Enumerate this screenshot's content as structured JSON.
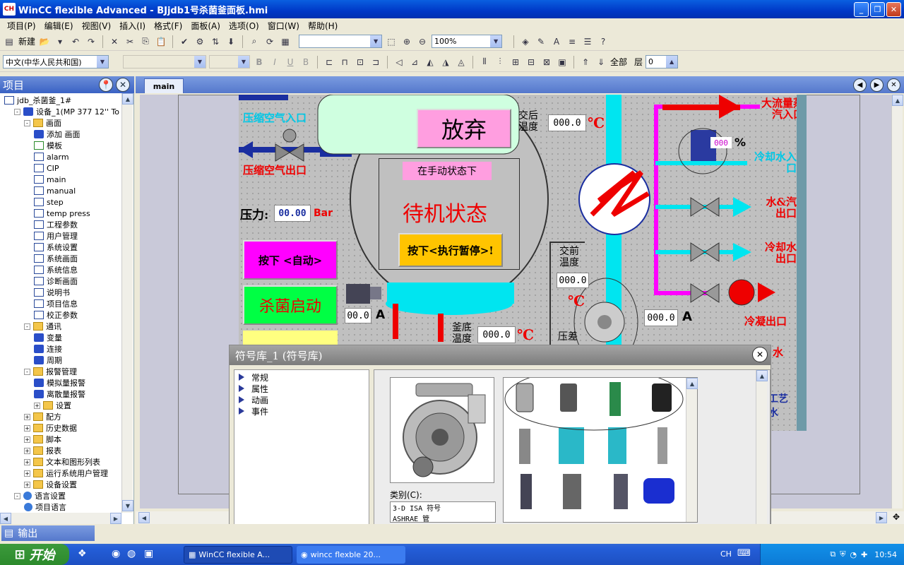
{
  "window": {
    "title": "WinCC flexible Advanced - BJjdb1号杀菌釜面板.hmi",
    "app_icon": "CH"
  },
  "menu": [
    "项目(P)",
    "编辑(E)",
    "视图(V)",
    "插入(I)",
    "格式(F)",
    "面板(A)",
    "选项(O)",
    "窗口(W)",
    "帮助(H)"
  ],
  "toolbar": {
    "new_label": "新建",
    "zoom_value": "100%",
    "language_value": "中文(中华人民共和国)",
    "all_label": "全部",
    "layer_label": "层",
    "layer_value": "0"
  },
  "project": {
    "header": "项目",
    "tree": [
      {
        "label": "jdb_杀菌釜_1#",
        "indent": 0,
        "icon": "project-icon"
      },
      {
        "label": "设备_1(MP 377 12'' To",
        "indent": 1,
        "icon": "device-icon",
        "exp": "-"
      },
      {
        "label": "画面",
        "indent": 2,
        "icon": "folder-icon",
        "exp": "-"
      },
      {
        "label": "添加 画面",
        "indent": 3,
        "icon": "add-screen-icon"
      },
      {
        "label": "模板",
        "indent": 3,
        "icon": "template-icon"
      },
      {
        "label": "alarm",
        "indent": 3,
        "icon": "screen-icon"
      },
      {
        "label": "CIP",
        "indent": 3,
        "icon": "screen-icon"
      },
      {
        "label": "main",
        "indent": 3,
        "icon": "screen-icon"
      },
      {
        "label": "manual",
        "indent": 3,
        "icon": "screen-icon"
      },
      {
        "label": "step",
        "indent": 3,
        "icon": "screen-icon"
      },
      {
        "label": "temp press",
        "indent": 3,
        "icon": "screen-icon"
      },
      {
        "label": "工程参数",
        "indent": 3,
        "icon": "screen-icon"
      },
      {
        "label": "用户管理",
        "indent": 3,
        "icon": "screen-icon"
      },
      {
        "label": "系统设置",
        "indent": 3,
        "icon": "screen-icon"
      },
      {
        "label": "系统画面",
        "indent": 3,
        "icon": "screen-icon"
      },
      {
        "label": "系统信息",
        "indent": 3,
        "icon": "screen-icon"
      },
      {
        "label": "诊断画面",
        "indent": 3,
        "icon": "screen-icon"
      },
      {
        "label": "说明书",
        "indent": 3,
        "icon": "screen-icon"
      },
      {
        "label": "项目信息",
        "indent": 3,
        "icon": "screen-icon"
      },
      {
        "label": "校正参数",
        "indent": 3,
        "icon": "screen-icon"
      },
      {
        "label": "通讯",
        "indent": 2,
        "icon": "folder-icon",
        "exp": "-"
      },
      {
        "label": "变量",
        "indent": 3,
        "icon": "tags-icon"
      },
      {
        "label": "连接",
        "indent": 3,
        "icon": "connection-icon"
      },
      {
        "label": "周期",
        "indent": 3,
        "icon": "cycle-icon"
      },
      {
        "label": "报警管理",
        "indent": 2,
        "icon": "folder-icon",
        "exp": "-"
      },
      {
        "label": "模拟量报警",
        "indent": 3,
        "icon": "analog-alarm-icon"
      },
      {
        "label": "离散量报警",
        "indent": 3,
        "icon": "discrete-alarm-icon"
      },
      {
        "label": "设置",
        "indent": 3,
        "icon": "folder-icon",
        "exp": "+"
      },
      {
        "label": "配方",
        "indent": 2,
        "icon": "folder-icon",
        "exp": "+"
      },
      {
        "label": "历史数据",
        "indent": 2,
        "icon": "folder-icon",
        "exp": "+"
      },
      {
        "label": "脚本",
        "indent": 2,
        "icon": "folder-icon",
        "exp": "+"
      },
      {
        "label": "报表",
        "indent": 2,
        "icon": "folder-icon",
        "exp": "+"
      },
      {
        "label": "文本和图形列表",
        "indent": 2,
        "icon": "folder-icon",
        "exp": "+"
      },
      {
        "label": "运行系统用户管理",
        "indent": 2,
        "icon": "folder-icon",
        "exp": "+"
      },
      {
        "label": "设备设置",
        "indent": 2,
        "icon": "folder-icon",
        "exp": "+"
      },
      {
        "label": "语言设置",
        "indent": 1,
        "icon": "globe-icon",
        "exp": "-"
      },
      {
        "label": "项目语言",
        "indent": 2,
        "icon": "globe-icon"
      }
    ]
  },
  "editor": {
    "tab_label": "main"
  },
  "hmi": {
    "compressed_air_in": "压缩空气入口",
    "compressed_air_out": "压缩空气出口",
    "abandon_button": "放弃",
    "manual_state_label": "在手动状态下",
    "standby_state": "待机状态",
    "pause_button": "按下<执行暂停>!",
    "pressure_label": "压力:",
    "pressure_value": "00.00",
    "pressure_unit": "Bar",
    "auto_button": "按下 <自动>",
    "sterilize_button": "杀菌启动",
    "current_left_value": "00.0",
    "current_unit": "A",
    "after_exchange_temp_label": "交后温度",
    "after_exchange_temp_value": "000.0",
    "before_exchange_temp_label": "交前温度",
    "before_exchange_temp_value": "000.0",
    "bottom_temp_label": "釜底温度",
    "bottom_temp_value": "000.0",
    "temp_unit": "℃",
    "pump_current_value": "000.0",
    "valve_percent_value": "000",
    "percent_unit": "%",
    "large_steam_in": "大流量蒸汽入口",
    "cooling_water_in": "冷却水入口",
    "water_steam_out": "水&汽出口",
    "cooling_water_out": "冷却水出口",
    "condensate_out": "冷凝出口",
    "diff_pressure": "压差",
    "water_partial": "水",
    "process_water_partial": "工艺水"
  },
  "symbol_library": {
    "title": "符号库_1 (符号库)",
    "properties": [
      "常规",
      "属性",
      "动画",
      "事件"
    ],
    "category_label": "类别(C):",
    "categories": [
      "3-D ISA 符号",
      "ASHRAE 管"
    ]
  },
  "output": {
    "label": "输出"
  },
  "taskbar": {
    "start_label": "开始",
    "tasks": [
      "WinCC flexible A...",
      "wincc flexble 20..."
    ],
    "lang": "CH",
    "clock": "10:54"
  }
}
